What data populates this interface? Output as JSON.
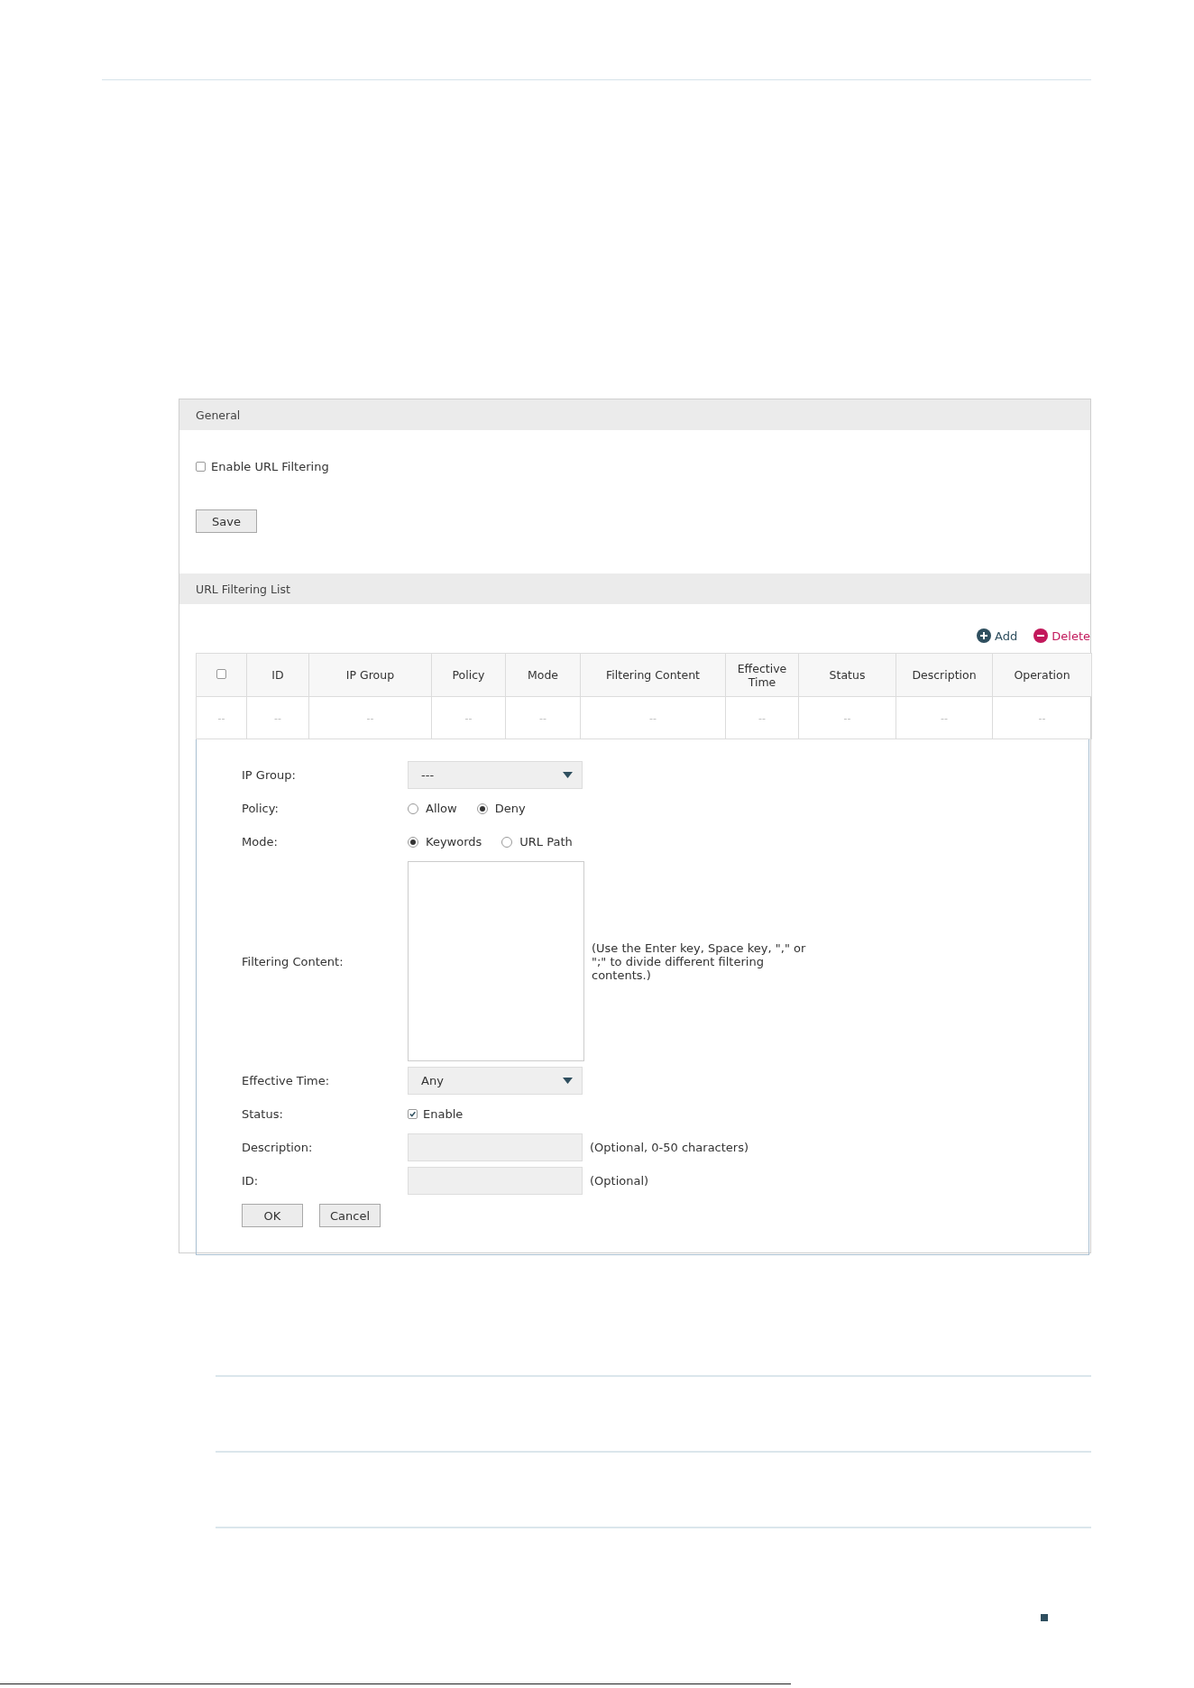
{
  "general": {
    "title": "General",
    "enable": {
      "label": "Enable URL Filtering",
      "checked": false
    },
    "save_button": "Save"
  },
  "list": {
    "title": "URL Filtering List",
    "actions": [
      {
        "kind": "add",
        "label": "Add"
      },
      {
        "kind": "delete",
        "label": "Delete"
      }
    ],
    "table": {
      "columns": [
        "",
        "ID",
        "IP Group",
        "Policy",
        "Mode",
        "Filtering Content",
        "Effective Time",
        "Status",
        "Description",
        "Operation"
      ],
      "select_all": {
        "checked": false
      },
      "rows": [
        [
          "--",
          "--",
          "--",
          "--",
          "--",
          "--",
          "--",
          "--",
          "--",
          "--"
        ]
      ]
    }
  },
  "form": {
    "fields": [
      {
        "kind": "select",
        "label": "IP Group:",
        "value": "---"
      },
      {
        "kind": "radio",
        "label": "Policy:",
        "options": [
          {
            "label": "Allow",
            "selected": false
          },
          {
            "label": "Deny",
            "selected": true
          }
        ]
      },
      {
        "kind": "radio",
        "label": "Mode:",
        "options": [
          {
            "label": "Keywords",
            "selected": true
          },
          {
            "label": "URL Path",
            "selected": false
          }
        ]
      },
      {
        "kind": "textarea",
        "label": "Filtering Content:",
        "hint": "(Use the Enter key, Space key, \",\" or \";\" to divide different filtering contents.)"
      },
      {
        "kind": "select",
        "label": "Effective Time:",
        "value": "Any"
      },
      {
        "kind": "checkbox",
        "label": "Status:",
        "option": "Enable",
        "checked": true
      },
      {
        "kind": "text",
        "label": "Description:",
        "hint": "(Optional, 0-50 characters)"
      },
      {
        "kind": "text",
        "label": "ID:",
        "hint": "(Optional)"
      }
    ],
    "buttons": [
      "OK",
      "Cancel"
    ]
  }
}
